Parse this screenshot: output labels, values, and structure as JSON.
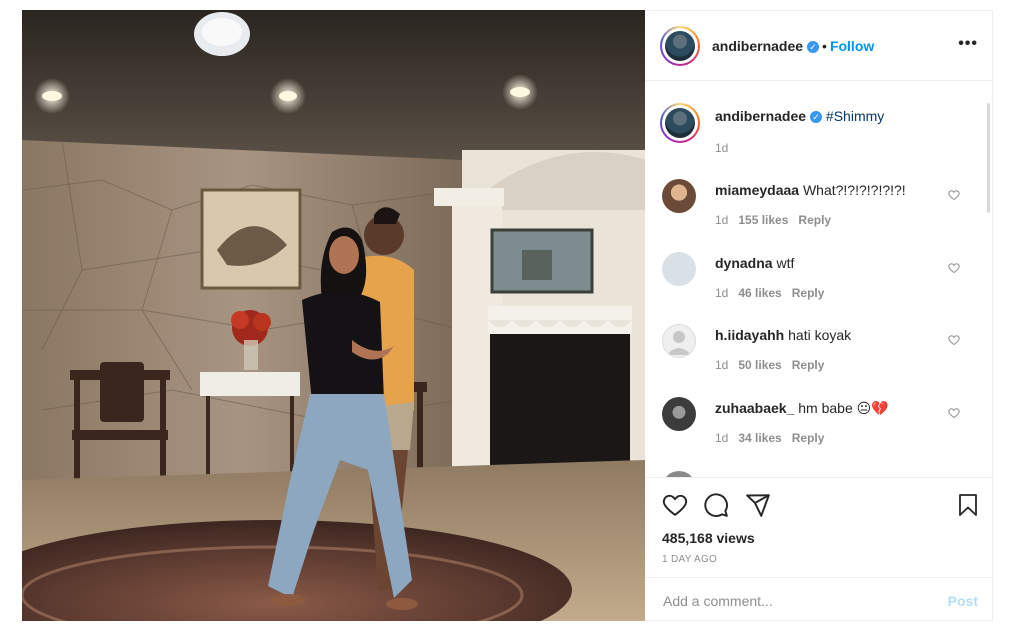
{
  "post": {
    "author": "andibernadee",
    "separator": "•",
    "follow_label": "Follow",
    "more_label": "•••",
    "caption": {
      "username": "andibernadee",
      "text": "#Shimmy",
      "age": "1d"
    },
    "comments": [
      {
        "username": "miameydaaa",
        "text": "What?!?!?!?!?!?!",
        "age": "1d",
        "likes": "155 likes",
        "reply": "Reply",
        "avatar_color": "#6b4a3a"
      },
      {
        "username": "dynadna",
        "text": "wtf",
        "age": "1d",
        "likes": "46 likes",
        "reply": "Reply",
        "avatar_color": "#d9e1e6"
      },
      {
        "username": "h.iidayahh",
        "text": "hati koyak",
        "age": "1d",
        "likes": "50 likes",
        "reply": "Reply",
        "avatar_color": "#dbdbdb"
      },
      {
        "username": "zuhaabaek_",
        "text": "hm babe 😐💔",
        "age": "1d",
        "likes": "34 likes",
        "reply": "Reply",
        "avatar_color": "#4a4a4a"
      }
    ],
    "views": "485,168 views",
    "time_ago": "1 DAY AGO",
    "comment_placeholder": "Add a comment...",
    "post_label": "Post"
  },
  "colors": {
    "accent": "#0095f6",
    "verified": "#3897f0",
    "muted": "#8e8e8e",
    "post_disabled": "#b2dffc"
  },
  "icons": [
    "verified-badge-icon",
    "more-options-icon",
    "heart-icon",
    "comment-icon",
    "share-icon",
    "bookmark-icon"
  ]
}
